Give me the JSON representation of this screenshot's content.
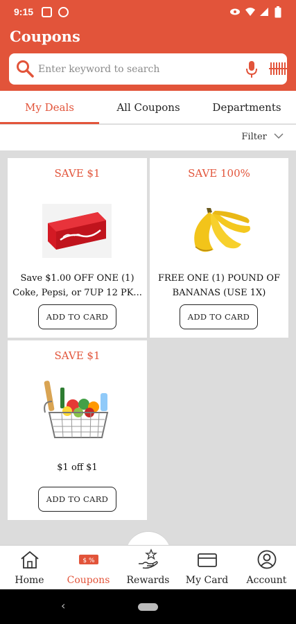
{
  "status": {
    "time": "9:15"
  },
  "header": {
    "title": "Coupons"
  },
  "search": {
    "placeholder": "Enter keyword to search"
  },
  "tabs": [
    {
      "label": "My Deals",
      "active": true
    },
    {
      "label": "All Coupons",
      "active": false
    },
    {
      "label": "Departments",
      "active": false
    }
  ],
  "filter": {
    "label": "Filter"
  },
  "coupons": [
    {
      "save": "SAVE $1",
      "description": "Save $1.00 OFF ONE (1) Coke, Pepsi, or 7UP 12 PK...",
      "button": "ADD TO CARD",
      "image": "coca-cola-12-pack"
    },
    {
      "save": "SAVE 100%",
      "description": "FREE ONE (1) POUND OF BANANAS (USE 1X)",
      "button": "ADD TO CARD",
      "image": "bananas"
    },
    {
      "save": "SAVE $1",
      "description": "$1 off $1",
      "button": "ADD TO CARD",
      "image": "grocery-basket"
    }
  ],
  "bottom_nav": [
    {
      "label": "Home",
      "icon": "house-icon",
      "active": false
    },
    {
      "label": "Coupons",
      "icon": "coupon-tag-icon",
      "active": true,
      "badge": "$ %"
    },
    {
      "label": "Rewards",
      "icon": "hand-star-icon",
      "active": false
    },
    {
      "label": "My Card",
      "icon": "card-icon",
      "active": false
    },
    {
      "label": "Account",
      "icon": "person-circle-icon",
      "active": false
    }
  ],
  "colors": {
    "brand": "#e2543a",
    "background": "#dcdcdc",
    "card": "#ffffff"
  }
}
